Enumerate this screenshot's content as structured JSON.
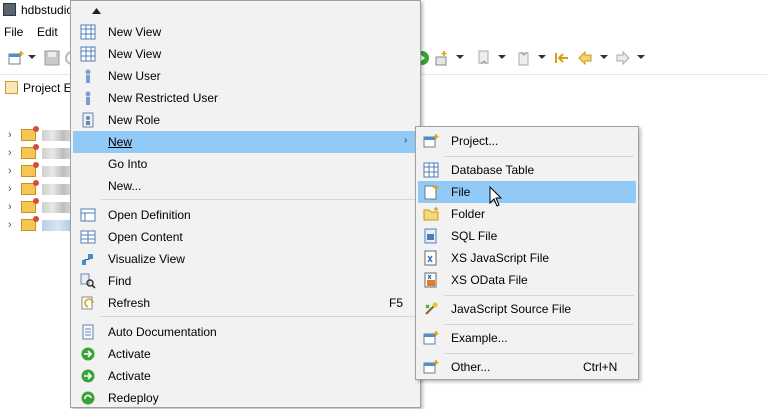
{
  "window": {
    "title": "hdbstudio"
  },
  "menubar": {
    "items": [
      {
        "label": "File"
      },
      {
        "label": "Edit"
      }
    ]
  },
  "project_tab": {
    "label": "Project E"
  },
  "context_menu": {
    "scroll_up_icon": "triangle-up",
    "items": [
      {
        "label": "New View",
        "icon": "table-view-icon"
      },
      {
        "label": "New View",
        "icon": "table-view-icon"
      },
      {
        "label": "New User",
        "icon": "user-icon"
      },
      {
        "label": "New Restricted User",
        "icon": "user-icon"
      },
      {
        "label": "New Role",
        "icon": "role-icon"
      },
      {
        "label": "New",
        "highlighted": true,
        "has_submenu": true
      },
      {
        "label": "Go Into"
      },
      {
        "label": "New..."
      },
      {
        "label": "Open Definition",
        "icon": "definition-icon"
      },
      {
        "label": "Open Content",
        "icon": "content-icon"
      },
      {
        "label": "Visualize View",
        "icon": "visualize-icon"
      },
      {
        "label": "Find",
        "icon": "find-icon"
      },
      {
        "label": "Refresh",
        "icon": "refresh-icon",
        "shortcut": "F5"
      },
      {
        "label": "Auto Documentation",
        "icon": "document-icon"
      },
      {
        "label": "Activate",
        "icon": "activate-icon"
      },
      {
        "label": "Activate",
        "icon": "activate-icon"
      },
      {
        "label": "Redeploy",
        "icon": "redeploy-icon"
      }
    ]
  },
  "submenu": {
    "items": [
      {
        "label": "Project...",
        "icon": "new-project-icon"
      },
      {
        "label": "Database Table",
        "icon": "database-table-icon"
      },
      {
        "label": "File",
        "icon": "new-file-icon",
        "highlighted": true
      },
      {
        "label": "Folder",
        "icon": "folder-icon"
      },
      {
        "label": "SQL File",
        "icon": "sql-file-icon"
      },
      {
        "label": "XS JavaScript File",
        "icon": "js-file-icon"
      },
      {
        "label": "XS OData File",
        "icon": "odata-file-icon"
      },
      {
        "label": "JavaScript Source File",
        "icon": "js-source-icon"
      },
      {
        "label": "Example...",
        "icon": "example-icon"
      },
      {
        "label": "Other...",
        "icon": "other-icon",
        "shortcut": "Ctrl+N"
      }
    ]
  },
  "colors": {
    "highlight": "#91c9f7",
    "menu_bg": "#f2f2f2",
    "menu_border": "#a0a0a0"
  }
}
